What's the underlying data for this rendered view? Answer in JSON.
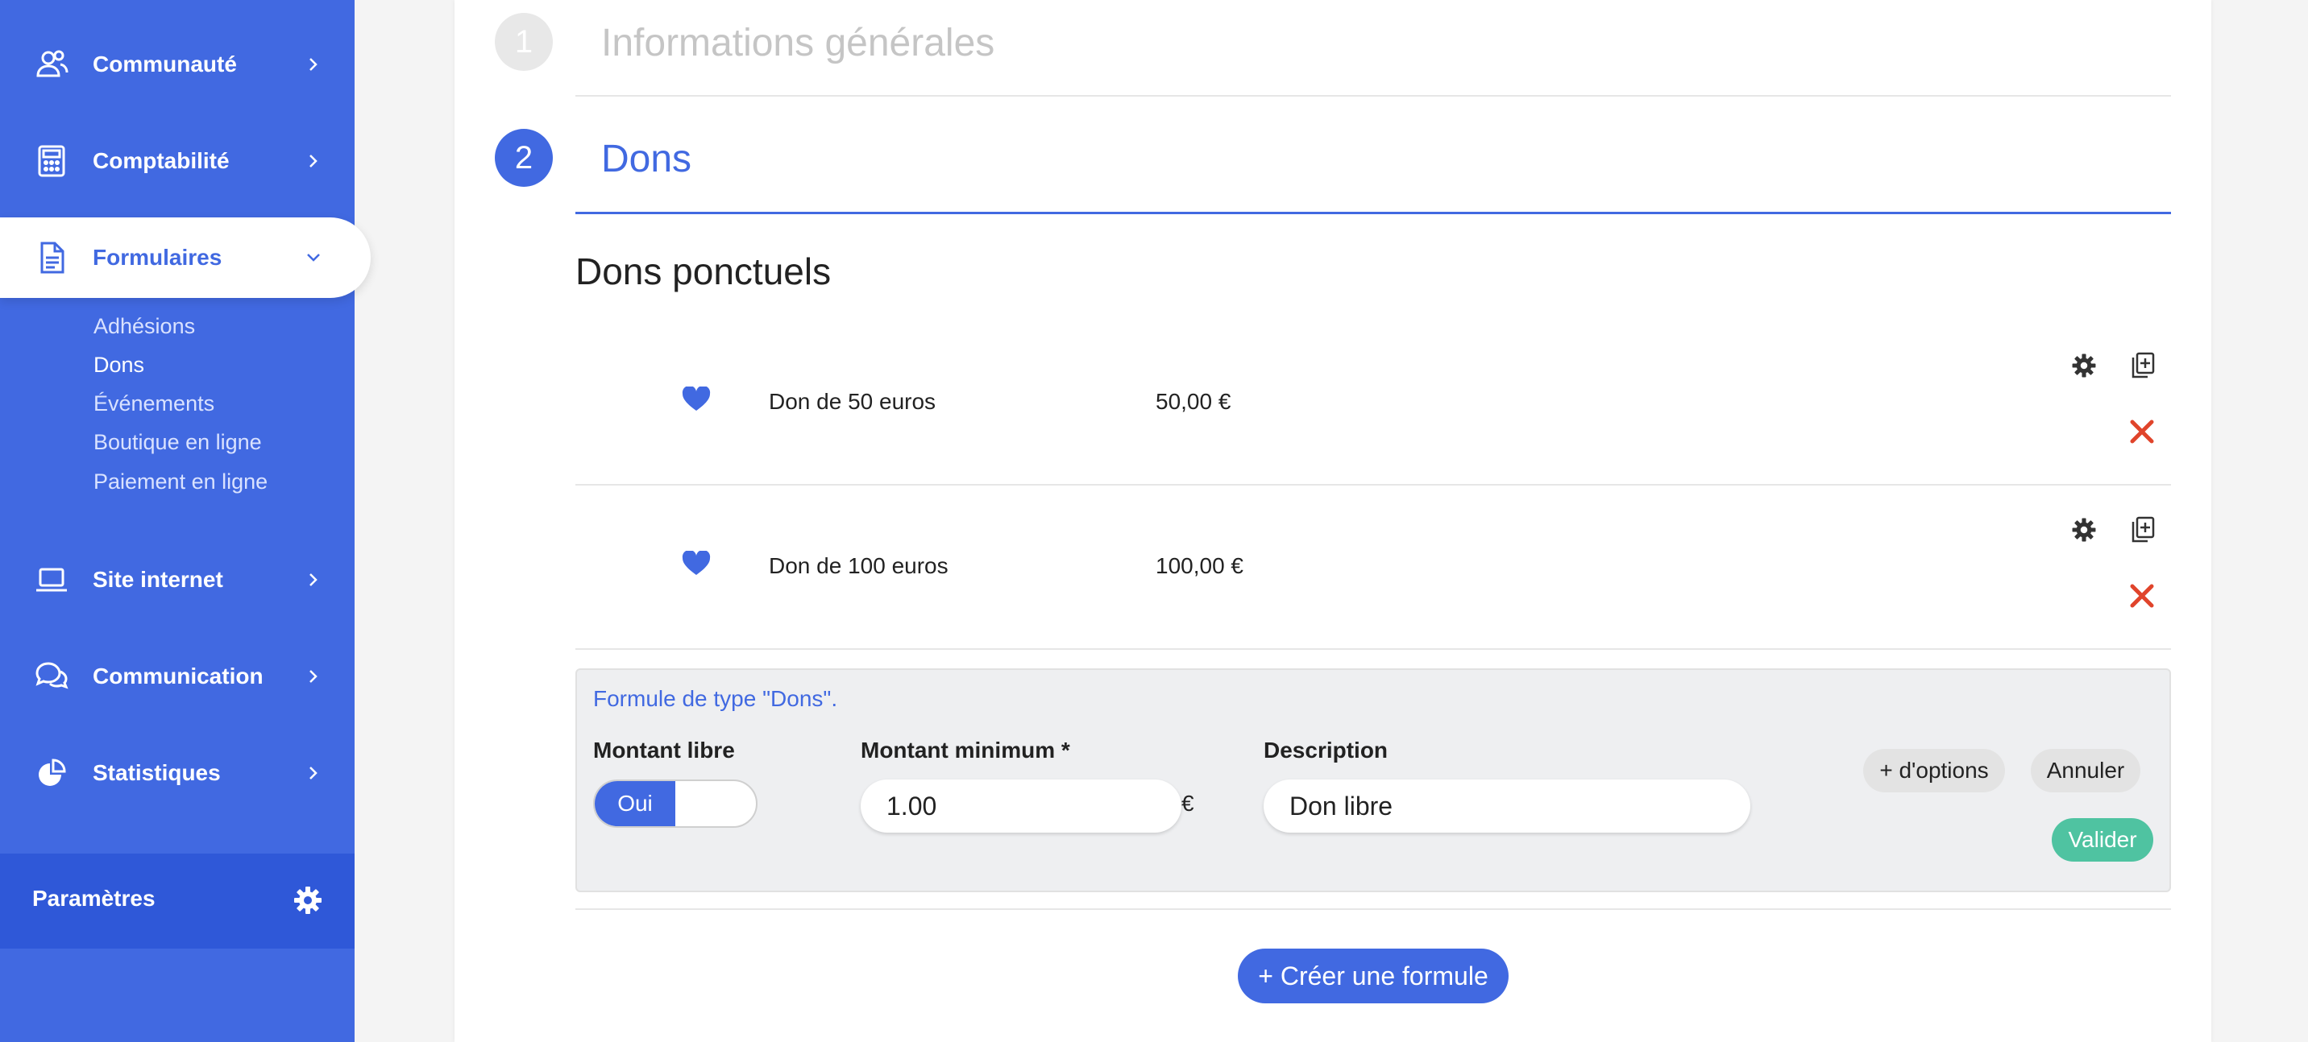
{
  "sidebar": {
    "items": [
      {
        "label": "Communauté",
        "icon": "users-icon"
      },
      {
        "label": "Comptabilité",
        "icon": "calculator-icon"
      },
      {
        "label": "Formulaires",
        "icon": "document-icon"
      },
      {
        "label": "Site internet",
        "icon": "laptop-icon"
      },
      {
        "label": "Communication",
        "icon": "chat-icon"
      },
      {
        "label": "Statistiques",
        "icon": "pie-chart-icon"
      }
    ],
    "subitems": [
      "Adhésions",
      "Dons",
      "Événements",
      "Boutique en ligne",
      "Paiement en ligne"
    ],
    "params_label": "Paramètres"
  },
  "steps": [
    {
      "number": "1",
      "title": "Informations générales"
    },
    {
      "number": "2",
      "title": "Dons"
    }
  ],
  "section_title": "Dons ponctuels",
  "dons": [
    {
      "name": "Don de 50 euros",
      "amount": "50,00 €"
    },
    {
      "name": "Don de 100 euros",
      "amount": "100,00 €"
    }
  ],
  "form": {
    "type_label": "Formule de type \"Dons\".",
    "montant_libre_label": "Montant libre",
    "toggle_on": "Oui",
    "montant_min_label": "Montant minimum *",
    "montant_min_value": "1.00",
    "currency": "€",
    "description_label": "Description",
    "description_value": "Don libre",
    "options_button": "+ d'options",
    "cancel_button": "Annuler",
    "validate_button": "Valider"
  },
  "create_button": "+ Créer une formule",
  "colors": {
    "accent": "#4169e1",
    "success": "#4fc3a1",
    "danger": "#e0442b"
  }
}
